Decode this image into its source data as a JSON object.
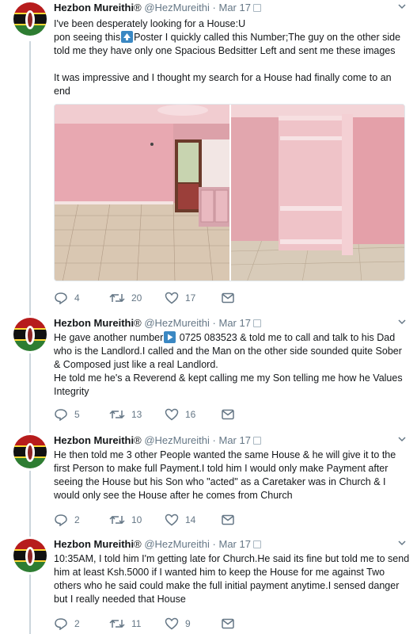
{
  "thread": {
    "author": {
      "name": "Hezbon Mureithi",
      "registered_mark": "®",
      "handle": "@HezMureithi",
      "separator": "·"
    },
    "tweets": [
      {
        "date": "Mar 17",
        "text_before_emoji": "I've been desperately looking for a House:U\npon seeing this",
        "emoji": "up-arrow-emoji",
        "text_after_emoji": "Poster I quickly called this Number;The guy on the other side told me they have only one Spacious Bedsitter Left and sent me these images\n\nIt was impressive and I thought my search for a House had finally come to an end",
        "media": [
          "pink-room-with-balcony-door",
          "pink-room-with-wardrobe-shelves"
        ],
        "replies": "4",
        "retweets": "20",
        "likes": "17"
      },
      {
        "date": "Mar 17",
        "text_before_emoji": "He gave another number",
        "emoji": "play-arrow-emoji",
        "text_after_emoji": " 0725 083523 & told me to call and talk to his Dad who is the Landlord.I called and the Man on the other side sounded quite Sober & Composed just like a real Landlord.\nHe told me he's a Reverend & kept calling me my Son telling me how he Values Integrity",
        "replies": "5",
        "retweets": "13",
        "likes": "16"
      },
      {
        "date": "Mar 17",
        "text": "He then told me 3 other People wanted the same House & he will give it to the first Person to make full Payment.I told him I would only make Payment after seeing the House but his Son who \"acted\" as a Caretaker was in Church & I would only see the House after he comes from Church",
        "replies": "2",
        "retweets": "10",
        "likes": "14"
      },
      {
        "date": "Mar 17",
        "text": "10:35AM, I told him I'm getting late for Church.He said its fine but told me to send him at least Ksh.5000 if I wanted him to keep the House for me against Two others who he said could make the full initial payment anytime.I sensed danger but I really needed that House",
        "replies": "2",
        "retweets": "11",
        "likes": "9"
      }
    ]
  },
  "colors": {
    "text": "#14171a",
    "muted": "#657786",
    "thread_line": "#ccd6dd",
    "emoji_blue": "#3b88c3"
  },
  "icons": [
    "reply-icon",
    "retweet-icon",
    "like-icon",
    "dm-icon",
    "caret-down-icon",
    "verified-badge-icon"
  ]
}
